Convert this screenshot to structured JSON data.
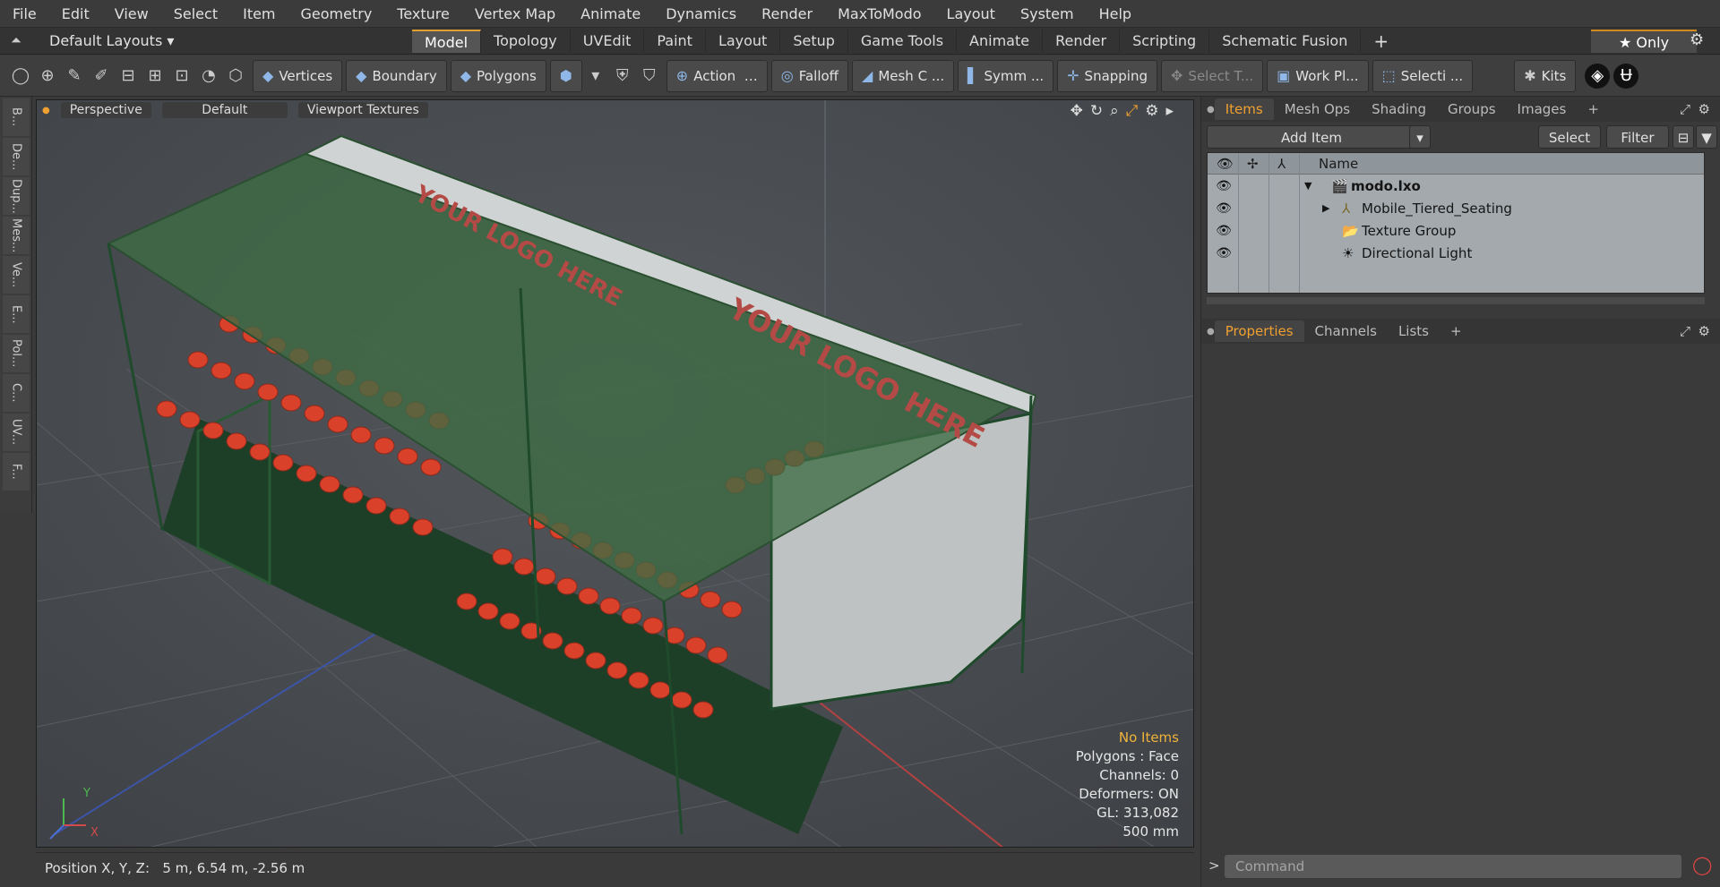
{
  "menubar": {
    "items": [
      "File",
      "Edit",
      "View",
      "Select",
      "Item",
      "Geometry",
      "Texture",
      "Vertex Map",
      "Animate",
      "Dynamics",
      "Render",
      "MaxToModo",
      "Layout",
      "System",
      "Help"
    ]
  },
  "layoutbar": {
    "layout_selector": "Default Layouts ▾",
    "tabs": [
      "Model",
      "Topology",
      "UVEdit",
      "Paint",
      "Layout",
      "Setup",
      "Game Tools",
      "Animate",
      "Render",
      "Scripting",
      "Schematic Fusion"
    ],
    "active_tab": "Model",
    "only_button": "★  Only"
  },
  "toolbar": {
    "vertices": "Vertices",
    "boundary": "Boundary",
    "polygons": "Polygons",
    "action": "Action",
    "falloff": "Falloff",
    "mesh": "Mesh C ...",
    "symmetry": "Symm ...",
    "snapping": "Snapping",
    "select_tool": "Select T...",
    "work_plane": "Work Pl...",
    "selection": "Selecti ...",
    "kits": "Kits"
  },
  "left_tabs": [
    "B...",
    "De...",
    "Dup...",
    "Mes...",
    "Ve...",
    "E...",
    "Pol...",
    "C...",
    "UV...",
    "F..."
  ],
  "viewport": {
    "view_mode": "Perspective",
    "shading": "Default",
    "textures": "Viewport Textures",
    "logo_text": "YOUR LOGO HERE",
    "axis_y": "Y",
    "axis_x": "X",
    "hud": {
      "selection": "No Items",
      "polygons": "Polygons : Face",
      "channels": "Channels: 0",
      "deformers": "Deformers: ON",
      "gl": "GL: 313,082",
      "scale": "500 mm"
    }
  },
  "status": {
    "position_label": "Position X, Y, Z:",
    "position_value": "5 m, 6.54 m, -2.56 m"
  },
  "items_panel": {
    "tabs": [
      "Items",
      "Mesh Ops",
      "Shading",
      "Groups",
      "Images"
    ],
    "active_tab": "Items",
    "add_item": "Add Item",
    "select": "Select",
    "filter": "Filter",
    "column_name": "Name",
    "tree": [
      {
        "name": "modo.lxo",
        "indent": 0
      },
      {
        "name": "Mobile_Tiered_Seating",
        "indent": 1
      },
      {
        "name": "Texture Group",
        "indent": 1
      },
      {
        "name": "Directional Light",
        "indent": 1
      }
    ]
  },
  "properties_panel": {
    "tabs": [
      "Properties",
      "Channels",
      "Lists"
    ],
    "active_tab": "Properties"
  },
  "command": {
    "placeholder": "Command"
  },
  "colors": {
    "accent": "#f0a030",
    "seat": "#d9412b",
    "frame": "#1f4a2c",
    "roof": "#3d6b44"
  }
}
